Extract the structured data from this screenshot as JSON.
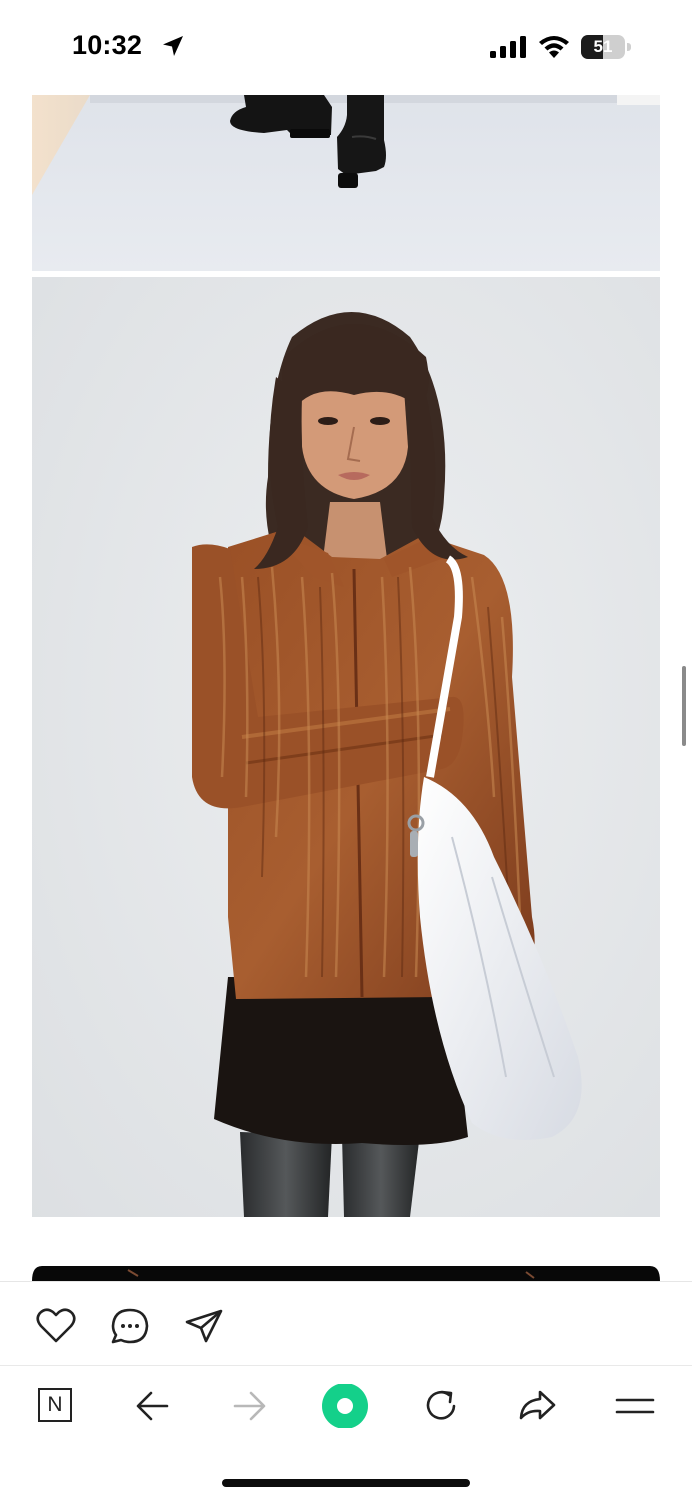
{
  "status_bar": {
    "time": "10:32",
    "battery_level": "51",
    "battery_fraction": 0.51,
    "icons": [
      "location-arrow-icon",
      "cellular-signal-icon",
      "wifi-icon",
      "battery-icon"
    ]
  },
  "feed": {
    "photos": [
      {
        "subject": "boots-on-floor"
      },
      {
        "subject": "model-in-rust-velvet-shirt-with-white-tote"
      },
      {
        "subject": "next-photo-partial"
      }
    ]
  },
  "actions": [
    {
      "icon": "heart-icon"
    },
    {
      "icon": "comment-icon"
    },
    {
      "icon": "send-icon"
    }
  ],
  "toolbar": {
    "items": [
      {
        "icon": "naver-n-icon",
        "label": "N"
      },
      {
        "icon": "back-arrow-icon"
      },
      {
        "icon": "forward-arrow-icon",
        "disabled": true
      },
      {
        "icon": "green-dot-icon"
      },
      {
        "icon": "refresh-icon"
      },
      {
        "icon": "share-icon"
      },
      {
        "icon": "menu-icon"
      }
    ]
  },
  "colors": {
    "accent_green": "#14d08a",
    "wall": "#e3e4e6",
    "shirt": "#8a4422",
    "text": "#000000"
  }
}
